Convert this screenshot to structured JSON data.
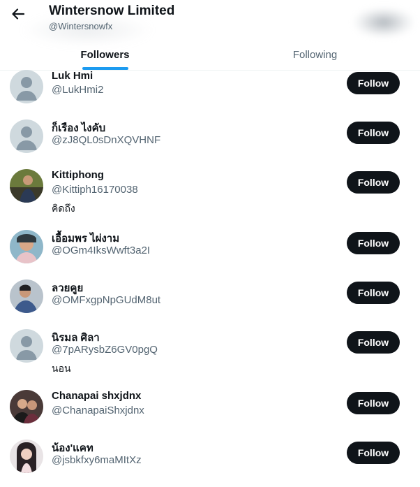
{
  "header": {
    "title": "Wintersnow Limited",
    "handle": "@Wintersnowfx",
    "back_icon": "arrow-left-icon"
  },
  "tabs": [
    {
      "label": "Followers",
      "active": true
    },
    {
      "label": "Following",
      "active": false
    }
  ],
  "colors": {
    "accent": "#1d9bf0",
    "button": "#0f1419",
    "secondary_text": "#536471"
  },
  "followers": [
    {
      "name": "Luk Hmi",
      "handle": "@LukHmi2",
      "bio": "",
      "button": "Follow",
      "avatar": "default-avatar-icon"
    },
    {
      "name": "ก็เรือง ไงคับ",
      "handle": "@zJ8QL0sDnXQVHNF",
      "bio": "",
      "button": "Follow",
      "avatar": "default-avatar-icon"
    },
    {
      "name": "Kittiphong",
      "handle": "@Kittiph16170038",
      "bio": "คิดถึง",
      "button": "Follow",
      "avatar": "photo-avatar"
    },
    {
      "name": "เอื้อมพร ไผ่งาม",
      "handle": "@OGm4IksWwft3a2I",
      "bio": "",
      "button": "Follow",
      "avatar": "photo-avatar"
    },
    {
      "name": "ลวยคูย",
      "handle": "@OMFxgpNpGUdM8ut",
      "bio": "",
      "button": "Follow",
      "avatar": "photo-avatar"
    },
    {
      "name": "นิรมล ศิลา",
      "handle": "@7pARysbZ6GV0pgQ",
      "bio": "นอน",
      "button": "Follow",
      "avatar": "default-avatar-icon"
    },
    {
      "name": "Chanapai shxjdnx",
      "handle": "@ChanapaiShxjdnx",
      "bio": "",
      "button": "Follow",
      "avatar": "photo-avatar"
    },
    {
      "name": "น้อง'แคท",
      "handle": "@jsbkfxy6maMItXz",
      "bio": "",
      "button": "Follow",
      "avatar": "photo-avatar"
    }
  ]
}
